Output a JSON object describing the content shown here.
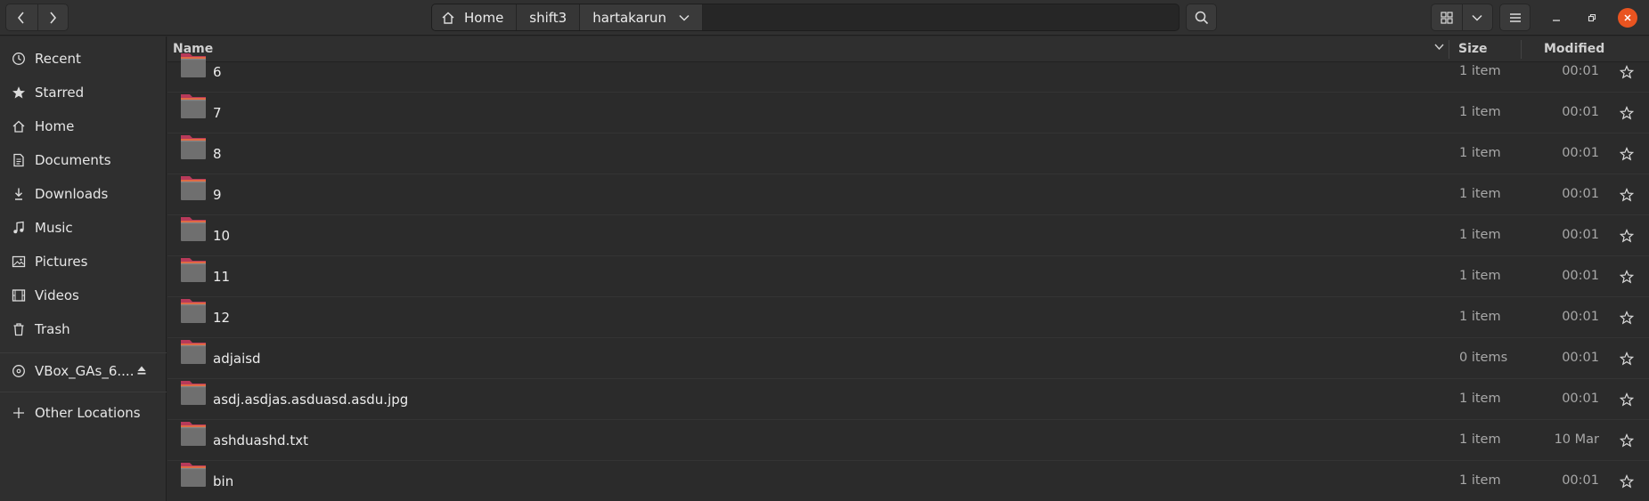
{
  "header": {
    "back_icon": "chevron-left-icon",
    "forward_icon": "chevron-right-icon",
    "breadcrumbs": [
      {
        "label": "Home",
        "icon": "home-icon"
      },
      {
        "label": "shift3"
      },
      {
        "label": "hartakarun",
        "icon": "chevron-down-icon"
      }
    ],
    "search_icon": "search-icon",
    "view_icon": "grid-view-icon",
    "view_menu_icon": "chevron-down-icon",
    "menu_icon": "hamburger-menu-icon",
    "accent_color": "#e95420"
  },
  "sidebar": {
    "items": [
      {
        "label": "Recent",
        "icon": "clock-icon"
      },
      {
        "label": "Starred",
        "icon": "star-icon"
      },
      {
        "label": "Home",
        "icon": "home-icon"
      },
      {
        "label": "Documents",
        "icon": "document-icon"
      },
      {
        "label": "Downloads",
        "icon": "download-icon"
      },
      {
        "label": "Music",
        "icon": "music-icon"
      },
      {
        "label": "Pictures",
        "icon": "picture-icon"
      },
      {
        "label": "Videos",
        "icon": "video-icon"
      },
      {
        "label": "Trash",
        "icon": "trash-icon"
      }
    ],
    "devices": [
      {
        "label": "VBox_GAs_6....",
        "icon": "disc-icon",
        "action_icon": "eject-icon"
      }
    ],
    "other": {
      "label": "Other Locations",
      "icon": "plus-icon"
    }
  },
  "list": {
    "columns": {
      "name": "Name",
      "size": "Size",
      "modified": "Modified"
    },
    "rows": [
      {
        "name": "6",
        "size": "1 item",
        "modified": "00:01"
      },
      {
        "name": "7",
        "size": "1 item",
        "modified": "00:01"
      },
      {
        "name": "8",
        "size": "1 item",
        "modified": "00:01"
      },
      {
        "name": "9",
        "size": "1 item",
        "modified": "00:01"
      },
      {
        "name": "10",
        "size": "1 item",
        "modified": "00:01"
      },
      {
        "name": "11",
        "size": "1 item",
        "modified": "00:01"
      },
      {
        "name": "12",
        "size": "1 item",
        "modified": "00:01"
      },
      {
        "name": "adjaisd",
        "size": "0 items",
        "modified": "00:01"
      },
      {
        "name": "asdj.asdjas.asduasd.asdu.jpg",
        "size": "1 item",
        "modified": "00:01"
      },
      {
        "name": "ashduashd.txt",
        "size": "1 item",
        "modified": "10 Mar"
      },
      {
        "name": "bin",
        "size": "1 item",
        "modified": "00:01"
      }
    ]
  }
}
